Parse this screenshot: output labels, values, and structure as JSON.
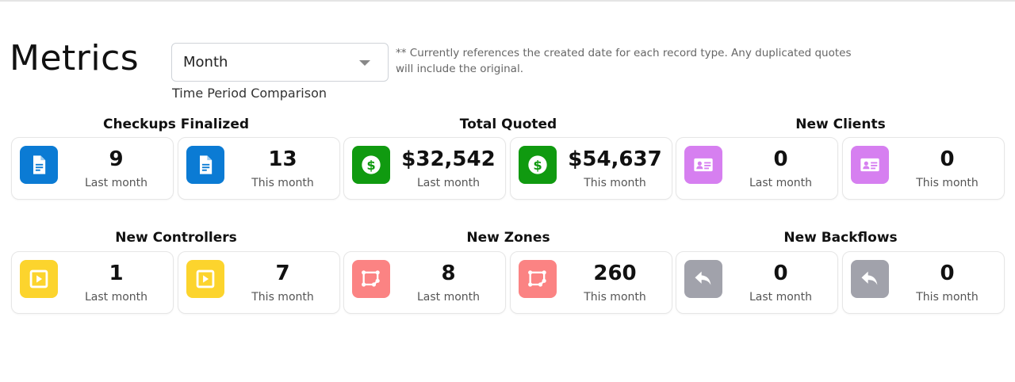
{
  "page": {
    "title": "Metrics"
  },
  "filter": {
    "selected": "Month",
    "label": "Time Period Comparison",
    "note": "**  Currently references the created date for each record type. Any duplicated quotes will include the original."
  },
  "colors": {
    "checkups": "#0b7bd4",
    "quoted": "#109a10",
    "clients": "#d67ff0",
    "controllers": "#fcd42d",
    "zones": "#fb8383",
    "backflows": "#a1a2ab"
  },
  "groups": [
    {
      "title": "Checkups Finalized",
      "icon": "document-icon",
      "cards": [
        {
          "value": "9",
          "caption": "Last month"
        },
        {
          "value": "13",
          "caption": "This month"
        }
      ]
    },
    {
      "title": "Total Quoted",
      "icon": "dollar-icon",
      "cards": [
        {
          "value": "$32,542",
          "caption": "Last month"
        },
        {
          "value": "$54,637",
          "caption": "This month"
        }
      ]
    },
    {
      "title": "New Clients",
      "icon": "id-card-icon",
      "cards": [
        {
          "value": "0",
          "caption": "Last month"
        },
        {
          "value": "0",
          "caption": "This month"
        }
      ]
    },
    {
      "title": "New Controllers",
      "icon": "play-square-icon",
      "cards": [
        {
          "value": "1",
          "caption": "Last month"
        },
        {
          "value": "7",
          "caption": "This month"
        }
      ]
    },
    {
      "title": "New Zones",
      "icon": "zones-icon",
      "cards": [
        {
          "value": "8",
          "caption": "Last month"
        },
        {
          "value": "260",
          "caption": "This month"
        }
      ]
    },
    {
      "title": "New Backflows",
      "icon": "reply-arrow-icon",
      "cards": [
        {
          "value": "0",
          "caption": "Last month"
        },
        {
          "value": "0",
          "caption": "This month"
        }
      ]
    }
  ]
}
